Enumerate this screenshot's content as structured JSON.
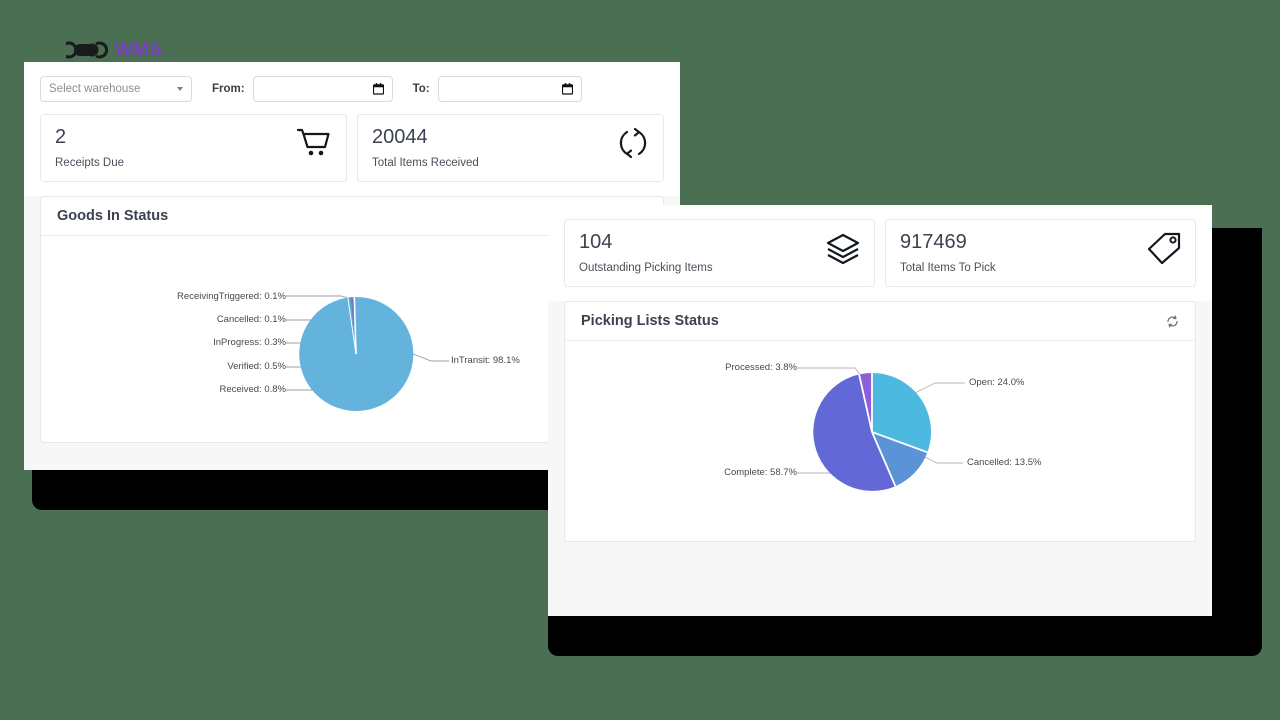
{
  "brand": {
    "mark_name": "csa-logo-mark",
    "text": "WMS",
    "text_color": "#7b3fc4"
  },
  "background_color": "#4a6f52",
  "goods_in_window": {
    "toolbar": {
      "warehouse_select": {
        "value": "Select warehouse",
        "placeholder": "Select warehouse",
        "options": [
          "Select warehouse"
        ]
      },
      "from_label": "From:",
      "from_value": "",
      "from_placeholder": "",
      "to_label": "To:",
      "to_value": "",
      "to_placeholder": ""
    },
    "kpis": [
      {
        "value": "2",
        "label": "Receipts Due",
        "icon": "shopping-cart-icon"
      },
      {
        "value": "20044",
        "label": "Total Items Received",
        "icon": "sync-refresh-icon"
      }
    ],
    "panel": {
      "title": "Goods In Status"
    }
  },
  "picking_window": {
    "kpis": [
      {
        "value": "104",
        "label": "Outstanding Picking Items",
        "icon": "layers-icon"
      },
      {
        "value": "917469",
        "label": "Total Items To Pick",
        "icon": "tag-icon"
      }
    ],
    "panel": {
      "title": "Picking Lists Status",
      "refresh_icon": "refresh-icon"
    }
  },
  "chart_data": [
    {
      "type": "pie",
      "title": "Goods In Status",
      "categories": [
        "InTransit",
        "Received",
        "Verified",
        "InProgress",
        "Cancelled",
        "ReceivingTriggered"
      ],
      "values": [
        98.1,
        0.8,
        0.5,
        0.3,
        0.1,
        0.1
      ],
      "unit": "%",
      "colors": [
        "#63b3dd",
        "#5aa9d4",
        "#5f7fc4",
        "#6a5fc4",
        "#7a55bd",
        "#8a50b5"
      ],
      "labels": [
        "InTransit: 98.1%",
        "Received: 0.8%",
        "Verified: 0.5%",
        "InProgress: 0.3%",
        "Cancelled: 0.1%",
        "ReceivingTriggered: 0.1%"
      ],
      "legend": "none",
      "label_position": "outside-with-leader-lines"
    },
    {
      "type": "pie",
      "title": "Picking Lists Status",
      "categories": [
        "Open",
        "Cancelled",
        "Complete",
        "Processed"
      ],
      "values": [
        24.0,
        13.5,
        58.7,
        3.8
      ],
      "unit": "%",
      "colors": [
        "#4db8e0",
        "#5a93d6",
        "#6269d6",
        "#8b5fd9"
      ],
      "labels": [
        "Open: 24.0%",
        "Cancelled: 13.5%",
        "Complete: 58.7%",
        "Processed: 3.8%"
      ],
      "legend": "none",
      "label_position": "outside-with-leader-lines"
    }
  ]
}
